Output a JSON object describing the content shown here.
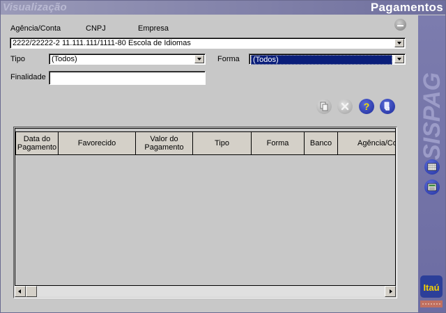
{
  "titlebar": {
    "left_title": "Visualização",
    "right_title": "Pagamentos"
  },
  "header": {
    "agencia_conta_label": "Agência/Conta",
    "cnpj_label": "CNPJ",
    "empresa_label": "Empresa",
    "account_value": "2222/22222-2  11.111.111/1111-80  Escola de Idiomas"
  },
  "filters": {
    "tipo_label": "Tipo",
    "tipo_value": "(Todos)",
    "forma_label": "Forma",
    "forma_value": "(Todos)",
    "finalidade_label": "Finalidade",
    "finalidade_value": ""
  },
  "toolbar": {
    "icons": [
      "copy-icon",
      "cancel-icon",
      "help-icon",
      "export-icon"
    ]
  },
  "table": {
    "columns": [
      "Data do Pagamento",
      "Favorecido",
      "Valor do Pagamento",
      "Tipo",
      "Forma",
      "Banco",
      "Agência/Co"
    ],
    "rows": []
  },
  "sidebar": {
    "brand_text": "SISPAG",
    "bank_logo_text": "Itaú",
    "icons": [
      "calendar-icon",
      "calculator-icon"
    ]
  },
  "colors": {
    "titlebar": "#8686ac",
    "sidebar": "#7474a8",
    "window_bg": "#c8c8c8",
    "selection": "#0a1e7a"
  }
}
